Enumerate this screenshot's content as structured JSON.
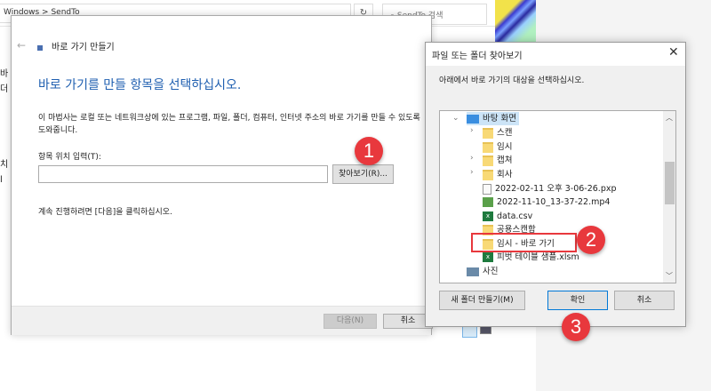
{
  "explorer": {
    "address": "Windows  >  SendTo",
    "refresh_icon": "refresh-icon",
    "search_placeholder": "SendTo 검색",
    "side_fragments": [
      "바",
      "더",
      "",
      "",
      "",
      "치",
      "l"
    ]
  },
  "wizard": {
    "title": "바로 가기 만들기",
    "heading": "바로 가기를 만들 항목을 선택하십시오.",
    "description": "이 마법사는 로컬 또는 네트워크상에 있는 프로그램, 파일, 폴더, 컴퓨터, 인터넷 주소의 바로 가기를 만들 수 있도록 도와줍니다.",
    "input_label": "항목 위치 입력(T):",
    "input_value": "",
    "browse_label": "찾아보기(R)...",
    "continue_text": "계속 진행하려면 [다음]을 클릭하십시오.",
    "next_label": "다음(N)",
    "cancel_label": "취소"
  },
  "browse": {
    "title": "파일 또는 폴더 찾아보기",
    "instruction": "아래에서 바로 가기의 대상을 선택하십시오.",
    "tree": [
      {
        "label": "바탕 화면",
        "icon": "desktop-icon",
        "expanded": true
      },
      {
        "label": "스캔",
        "icon": "folder-icon"
      },
      {
        "label": "임시",
        "icon": "folder-icon"
      },
      {
        "label": "캡쳐",
        "icon": "folder-icon"
      },
      {
        "label": "회사",
        "icon": "folder-icon"
      },
      {
        "label": "2022-02-11 오후 3-06-26.pxp",
        "icon": "file-icon"
      },
      {
        "label": "2022-11-10_13-37-22.mp4",
        "icon": "video-icon"
      },
      {
        "label": "data.csv",
        "icon": "excel-icon"
      },
      {
        "label": "공용스캔함",
        "icon": "folder-shortcut-icon"
      },
      {
        "label": "임시 - 바로 가기",
        "icon": "folder-shortcut-icon"
      },
      {
        "label": "피벗 테이블 샘플.xlsm",
        "icon": "excel-icon"
      },
      {
        "label": "사진",
        "icon": "pictures-icon"
      }
    ],
    "new_folder_label": "새 폴더 만들기(M)",
    "ok_label": "확인",
    "cancel_label": "취소"
  },
  "annotations": {
    "step1": "1",
    "step2": "2",
    "step3": "3",
    "color": "#e8383d"
  }
}
